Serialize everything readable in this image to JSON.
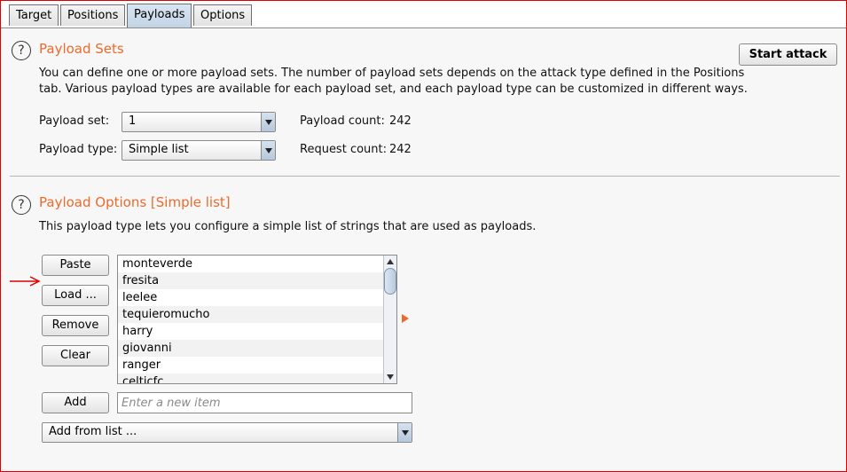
{
  "tabs": [
    "Target",
    "Positions",
    "Payloads",
    "Options"
  ],
  "active_tab": "Payloads",
  "payload_sets": {
    "title": "Payload Sets",
    "description_line1": "You can define one or more payload sets. The number of payload sets depends on the attack type defined in the Positions",
    "description_line2": "tab. Various payload types are available for each payload set, and each payload type can be customized in different ways.",
    "start_attack_label": "Start attack",
    "payload_set_label": "Payload set:",
    "payload_set_value": "1",
    "payload_type_label": "Payload type:",
    "payload_type_value": "Simple list",
    "payload_count_label": "Payload count:",
    "payload_count_value": "242",
    "request_count_label": "Request count:",
    "request_count_value": "242"
  },
  "payload_options": {
    "title": "Payload Options [Simple list]",
    "description": "This payload type lets you configure a simple list of strings that are used as payloads.",
    "buttons": {
      "paste": "Paste",
      "load": "Load ...",
      "remove": "Remove",
      "clear": "Clear",
      "add": "Add"
    },
    "items": [
      "monteverde",
      "fresita",
      "leelee",
      "tequieromucho",
      "harry",
      "giovanni",
      "ranger",
      "celticfc"
    ],
    "new_item_placeholder": "Enter a new item",
    "add_from_list_label": "Add from list ..."
  },
  "colors": {
    "section_title": "#ec6a2c",
    "annotation_arrow": "#e00000",
    "frame_border": "#e00000"
  },
  "help_icon_glyph": "?"
}
